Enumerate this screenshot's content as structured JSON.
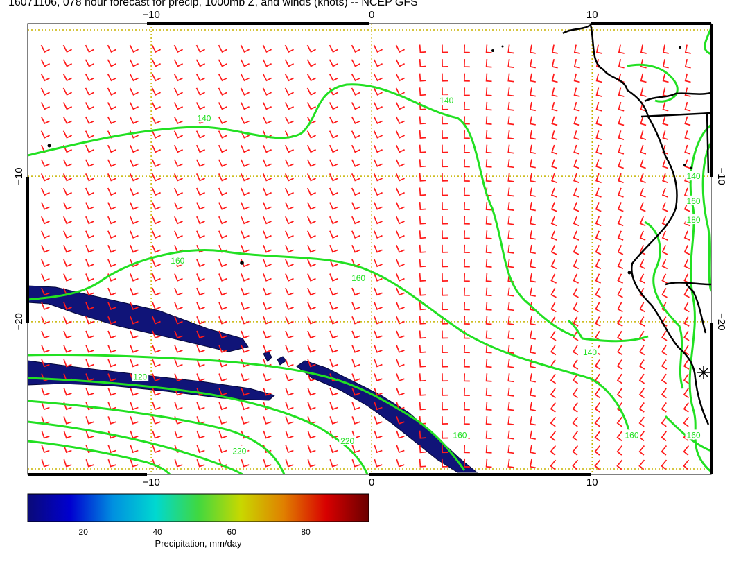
{
  "title": "16071106, 078 hour forecast for precip, 1000mb Z, and winds (knots) -- NCEP GFS",
  "map": {
    "lon_range": [
      -15.6,
      15.4
    ],
    "lat_range": [
      -30.5,
      0.5
    ],
    "lon_ticks": [
      {
        "value": -10,
        "label": "−10"
      },
      {
        "value": 0,
        "label": "0"
      },
      {
        "value": 10,
        "label": "10"
      }
    ],
    "lat_ticks": [
      {
        "value": -10,
        "label": "−10"
      },
      {
        "value": -20,
        "label": "−20"
      }
    ],
    "graticule_color": "#c8b400",
    "contour_color": "#22e022",
    "wind_barb_color": "#ff1a1a",
    "coast_color": "#000000",
    "precip_color": "#101478",
    "contour_labels": [
      {
        "text": "140",
        "lon": -7.6,
        "lat": -6.0
      },
      {
        "text": "140",
        "lon": 3.4,
        "lat": -4.8
      },
      {
        "text": "160",
        "lon": -8.8,
        "lat": -15.8
      },
      {
        "text": "160",
        "lon": -0.6,
        "lat": -17.0
      },
      {
        "text": "140",
        "lon": 9.9,
        "lat": -22.1
      },
      {
        "text": "120",
        "lon": -10.5,
        "lat": -23.8
      },
      {
        "text": "220",
        "lon": -6.0,
        "lat": -28.9
      },
      {
        "text": "220",
        "lon": -1.1,
        "lat": -28.2
      },
      {
        "text": "160",
        "lon": 4.0,
        "lat": -27.8
      },
      {
        "text": "160",
        "lon": 11.8,
        "lat": -27.8
      },
      {
        "text": "160",
        "lon": 14.6,
        "lat": -27.8
      },
      {
        "text": "140",
        "lon": 14.6,
        "lat": -10.0
      },
      {
        "text": "160",
        "lon": 14.6,
        "lat": -11.7
      },
      {
        "text": "180",
        "lon": 14.6,
        "lat": -13.0
      }
    ]
  },
  "colorbar": {
    "label": "Precipitation, mm/day",
    "range": [
      5,
      97
    ],
    "ticks": [
      {
        "value": 20,
        "label": "20"
      },
      {
        "value": 40,
        "label": "40"
      },
      {
        "value": 60,
        "label": "60"
      },
      {
        "value": 80,
        "label": "80"
      }
    ],
    "stops": [
      "#0a0a78",
      "#0000d0",
      "#0090e0",
      "#00d8d0",
      "#40d840",
      "#c8d800",
      "#e08000",
      "#d80000",
      "#6a0000"
    ]
  }
}
